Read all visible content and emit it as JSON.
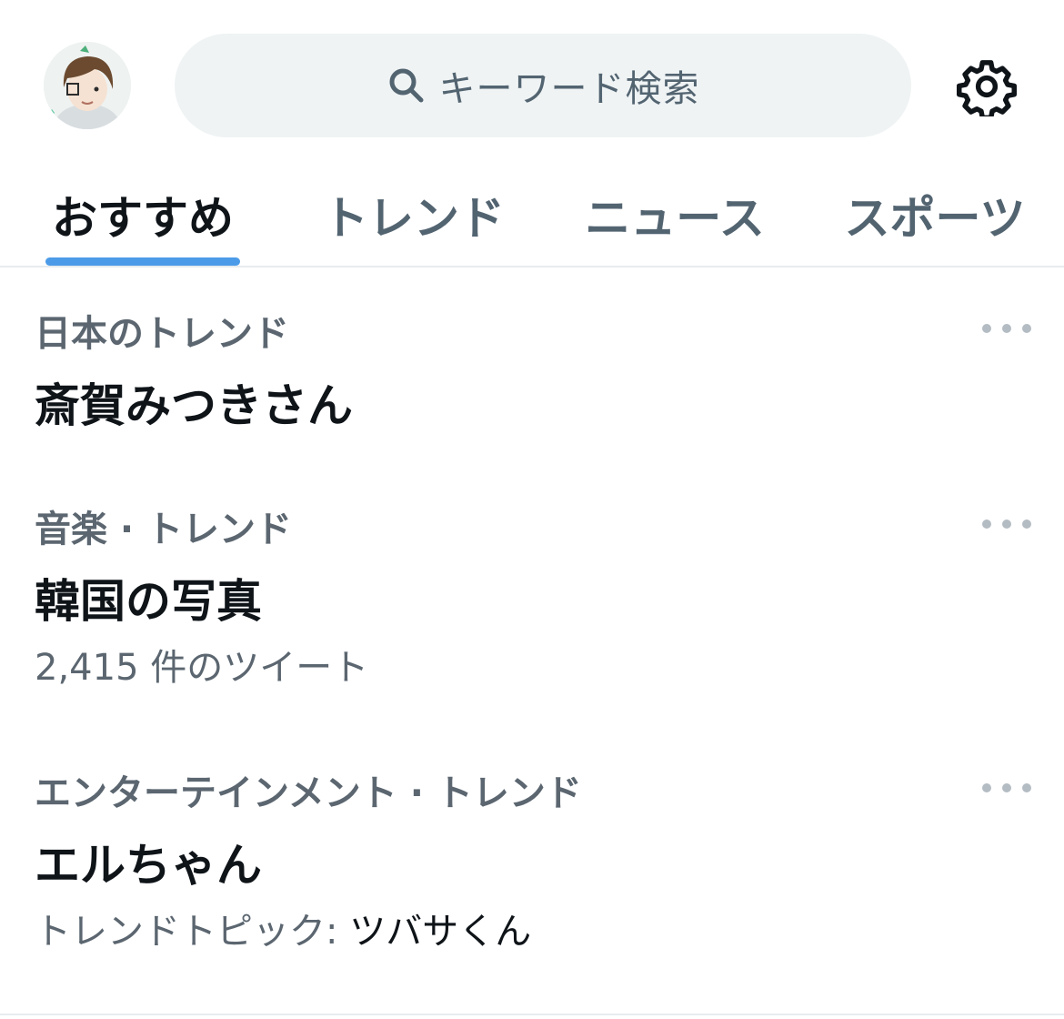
{
  "header": {
    "search_placeholder": "キーワード検索",
    "icons": [
      "search-icon",
      "gear-icon"
    ]
  },
  "tabs": [
    {
      "label": "おすすめ",
      "active": true
    },
    {
      "label": "トレンド",
      "active": false
    },
    {
      "label": "ニュース",
      "active": false
    },
    {
      "label": "スポーツ",
      "active": false
    }
  ],
  "trends": [
    {
      "category": "日本のトレンド",
      "title": "斎賀みつきさん"
    },
    {
      "category": "音楽 · トレンド",
      "title": "韓国の写真",
      "count": "2,415 件のツイート"
    },
    {
      "category": "エンターテインメント · トレンド",
      "title": "エルちゃん",
      "topic_prefix": "トレンドトピック: ",
      "topic": "ツバサくん"
    }
  ],
  "colors": {
    "accent": "#4c9be8",
    "muted_text": "#536471",
    "search_bg": "#eff3f4"
  }
}
